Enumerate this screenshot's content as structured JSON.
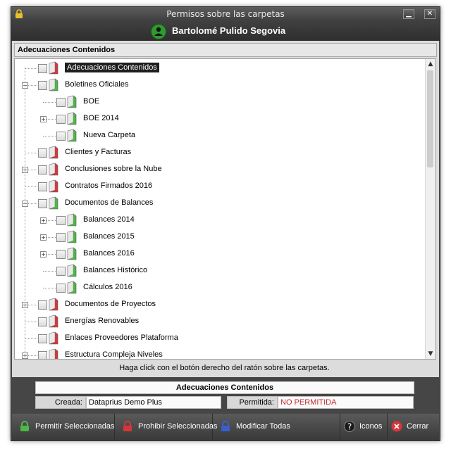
{
  "window": {
    "title": "Permisos sobre las carpetas",
    "minimize_glyph": "▁",
    "close_glyph": "✕"
  },
  "user": {
    "name": "Bartolomé Pulido Segovia"
  },
  "section": {
    "header": "Adecuaciones Contenidos"
  },
  "tree": {
    "items": [
      {
        "label": "Adecuaciones Contenidos",
        "level": 0,
        "expander": "",
        "status": "red",
        "selected": true
      },
      {
        "label": "Boletines Oficiales",
        "level": 0,
        "expander": "−",
        "status": "green"
      },
      {
        "label": "BOE",
        "level": 1,
        "expander": "",
        "status": "green"
      },
      {
        "label": "BOE 2014",
        "level": 1,
        "expander": "+",
        "status": "green"
      },
      {
        "label": "Nueva Carpeta",
        "level": 1,
        "expander": "",
        "status": "green"
      },
      {
        "label": "Clientes y Facturas",
        "level": 0,
        "expander": "",
        "status": "red"
      },
      {
        "label": "Conclusiones sobre la Nube",
        "level": 0,
        "expander": "+",
        "status": "red"
      },
      {
        "label": "Contratos Firmados 2016",
        "level": 0,
        "expander": "",
        "status": "red"
      },
      {
        "label": "Documentos de Balances",
        "level": 0,
        "expander": "−",
        "status": "green"
      },
      {
        "label": "Balances 2014",
        "level": 1,
        "expander": "+",
        "status": "green"
      },
      {
        "label": "Balances 2015",
        "level": 1,
        "expander": "+",
        "status": "green"
      },
      {
        "label": "Balances 2016",
        "level": 1,
        "expander": "+",
        "status": "green"
      },
      {
        "label": "Balances Histórico",
        "level": 1,
        "expander": "",
        "status": "green"
      },
      {
        "label": "Cálculos 2016",
        "level": 1,
        "expander": "",
        "status": "green"
      },
      {
        "label": "Documentos de Proyectos",
        "level": 0,
        "expander": "+",
        "status": "red"
      },
      {
        "label": "Energías Renovables",
        "level": 0,
        "expander": "",
        "status": "red"
      },
      {
        "label": "Enlaces Proveedores Plataforma",
        "level": 0,
        "expander": "",
        "status": "red"
      },
      {
        "label": "Estructura Compleja Niveles",
        "level": 0,
        "expander": "+",
        "status": "red"
      }
    ]
  },
  "hint": "Haga click con el botón derecho del ratón sobre las carpetas.",
  "info": {
    "title": "Adecuaciones Contenidos",
    "created_label": "Creada:",
    "created_value": "Dataprius Demo Plus",
    "allowed_label": "Permitida:",
    "allowed_value": "NO PERMITIDA"
  },
  "toolbar": {
    "allow_label": "Permitir Seleccionadas",
    "deny_label": "Prohibir Seleccionadas",
    "modify_label": "Modificar Todas",
    "icons_label": "Iconos",
    "close_label": "Cerrar"
  },
  "colors": {
    "green": "#4cb848",
    "red": "#d8353a",
    "blue": "#3a5fcd",
    "denied_text": "#c0282d"
  }
}
